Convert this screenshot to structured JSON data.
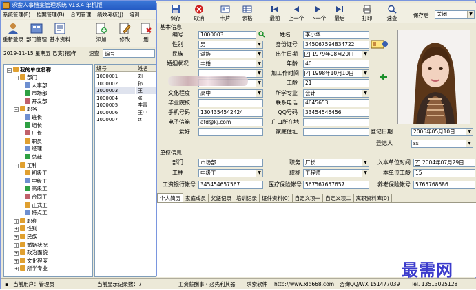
{
  "app": {
    "title": "求索人事档案管理系统 v13.4 单机版",
    "menu": [
      "系统管理(F)",
      "档案管理(B)",
      "合同管理",
      "绩效考核(J)",
      "培训"
    ]
  },
  "left_toolbar": {
    "buttons": [
      {
        "label": "重新登录",
        "icon": "relogin-icon"
      },
      {
        "label": "部门管理",
        "icon": "department-icon"
      },
      {
        "label": "基本资料",
        "icon": "basic-data-icon"
      },
      {
        "label": "添加",
        "icon": "add-icon"
      },
      {
        "label": "修改",
        "icon": "edit-icon"
      },
      {
        "label": "删",
        "icon": "delete-icon"
      }
    ]
  },
  "dateline": {
    "text": "2019-11-15 星期五 己亥(猪)年",
    "search_label": "速查",
    "search_value": "编号"
  },
  "tree": {
    "root": "我的单位名称",
    "nodes": [
      {
        "label": "部门",
        "level": 1,
        "expanded": true
      },
      {
        "label": "人事部",
        "level": 2
      },
      {
        "label": "市场部",
        "level": 2
      },
      {
        "label": "开发部",
        "level": 2
      },
      {
        "label": "职务",
        "level": 1,
        "expanded": true
      },
      {
        "label": "班长",
        "level": 2
      },
      {
        "label": "组长",
        "level": 2
      },
      {
        "label": "厂长",
        "level": 2
      },
      {
        "label": "职员",
        "level": 2
      },
      {
        "label": "经理",
        "level": 2
      },
      {
        "label": "总裁",
        "level": 2
      },
      {
        "label": "工种",
        "level": 1,
        "expanded": true
      },
      {
        "label": "初级工",
        "level": 2
      },
      {
        "label": "中级工",
        "level": 2
      },
      {
        "label": "高级工",
        "level": 2
      },
      {
        "label": "合同工",
        "level": 2
      },
      {
        "label": "正式工",
        "level": 2
      },
      {
        "label": "特点工",
        "level": 2
      },
      {
        "label": "职称",
        "level": 1
      },
      {
        "label": "性别",
        "level": 1
      },
      {
        "label": "民族",
        "level": 1
      },
      {
        "label": "婚姻状况",
        "level": 1
      },
      {
        "label": "政治面貌",
        "level": 1
      },
      {
        "label": "文化程度",
        "level": 1
      },
      {
        "label": "所学专业",
        "level": 1
      }
    ]
  },
  "grid": {
    "headers": [
      "编号",
      "姓名"
    ],
    "rows": [
      [
        "1000001",
        "刘"
      ],
      [
        "1000002",
        "孙"
      ],
      [
        "1000003",
        "王"
      ],
      [
        "1000004",
        "张"
      ],
      [
        "1000005",
        "李青"
      ],
      [
        "1000006",
        "王中"
      ],
      [
        "1000007",
        "tt"
      ]
    ]
  },
  "status": {
    "user": "当前用户：管理员",
    "count": "当前显示记录数：7",
    "slogan": "工资薪酬事・必先利其器",
    "company": "求索软件",
    "url": "http://www.xlq668.com",
    "qq": "咨询QQ/WX 151477039",
    "tel": "Tel. 13513025128"
  },
  "dialog": {
    "toolbar": [
      {
        "label": "保存",
        "icon": "save-icon"
      },
      {
        "label": "取消",
        "icon": "cancel-icon"
      },
      {
        "label": "卡片",
        "icon": "card-icon"
      },
      {
        "label": "表格",
        "icon": "table-icon"
      },
      {
        "label": "最前",
        "icon": "first-icon"
      },
      {
        "label": "上一个",
        "icon": "prev-icon"
      },
      {
        "label": "下一个",
        "icon": "next-icon"
      },
      {
        "label": "最后",
        "icon": "last-icon"
      },
      {
        "label": "打印",
        "icon": "print-icon"
      },
      {
        "label": "速查",
        "icon": "quick-search-icon"
      }
    ],
    "after_save_label": "保存后",
    "after_save_value": "关闭",
    "section_basic": "基本信息",
    "section_unit": "单位信息",
    "fields": {
      "id_label": "编号",
      "id_value": "1000003",
      "name_label": "姓名",
      "name_value": "李小华",
      "gender_label": "性别",
      "gender_value": "男",
      "idcard_label": "身份证号",
      "idcard_value": "345067594834722",
      "ethnic_label": "民族",
      "ethnic_value": "满族",
      "birth_label": "出生日期",
      "birth_value": "1979年08月20日",
      "marital_label": "婚姻状况",
      "marital_value": "丰婚",
      "age_label": "年龄",
      "age_value": "40",
      "joindate_label": "加工作时间",
      "joindate_value": "1998年10月10日",
      "seniority_label": "工龄",
      "seniority_value": "21",
      "edu_label": "文化程度",
      "edu_value": "高中",
      "major_label": "所学专业",
      "major_value": "会计",
      "school_label": "毕业院校",
      "school_value": "",
      "phone_label": "联系电话",
      "phone_value": "4645653",
      "mobile_label": "手机号码",
      "mobile_value": "1304354542424",
      "qq_label": "QQ号码",
      "qq_value": "33454546456",
      "email_label": "电子信箱",
      "email_value": "afd@kj.com",
      "hukou_label": "户口所在地",
      "hukou_value": "",
      "regdate_label": "登记日期",
      "regdate_value": "2006年05月10日",
      "hobby_label": "爱好",
      "hobby_value": "",
      "home_label": "家庭住址",
      "home_value": "",
      "registrar_label": "登记人",
      "registrar_value": "ss",
      "dept_label": "部门",
      "dept_value": "市场部",
      "position_label": "职务",
      "position_value": "厂长",
      "entry_label": "入本单位时间",
      "entry_value": "2004年07月29日",
      "worktype_label": "工种",
      "worktype_value": "中级工",
      "title_label": "职称",
      "title_value": "工程师",
      "unitage_label": "本单位工龄",
      "unitage_value": "15",
      "bank_label": "工资银行帐号",
      "bank_value": "345454657567",
      "medical_label": "医疗保险帐号",
      "medical_value": "567567657657",
      "pension_label": "养老保险帐号",
      "pension_value": "5765768686"
    },
    "tabs": [
      "个人简历",
      "家庭成员",
      "奖惩记录",
      "培训记录",
      "证件资料(0)",
      "自定义项一",
      "自定义项二",
      "离职资料库(0)"
    ]
  },
  "watermark": "最需网"
}
